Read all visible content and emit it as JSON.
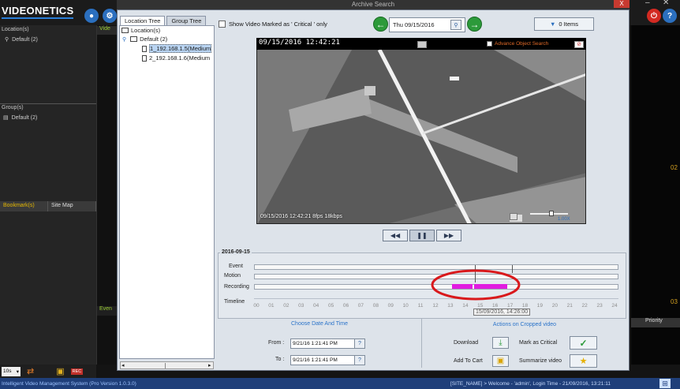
{
  "app": {
    "brand": "VIDEONETICS",
    "locations_header": "Location(s)",
    "locations_default": "Default (2)",
    "groups_header": "Group(s)",
    "groups_default": "Default (2)",
    "mid_strip_labels": [
      "Vide",
      "Even"
    ],
    "bookmark_tabs": [
      "Bookmark(s)",
      "Site Map"
    ],
    "right_strip": {
      "top_number": "02",
      "bottom_number": "03",
      "priority": "Priority"
    },
    "toolbar_dropdown": "10s",
    "toolbar_rec": "REC",
    "status_left": "Intelligent Video Management System (Pro Version 1.0.3.0)",
    "status_right": "[SITE_NAME] > Welcome - 'admin',  Login Time - 21/09/2016, 13:21:11"
  },
  "dialog": {
    "title": "Archive Search",
    "close": "X",
    "tree_tabs": [
      "Location Tree",
      "Group Tree"
    ],
    "tree": {
      "root": "Location(s)",
      "folder": "Default (2)",
      "cameras": [
        "1_192.168.1.5(Medium",
        "2_192.168.1.6(Medium"
      ]
    },
    "critical_label": "Show Video Marked as ' Critical ' only",
    "date": "Thu 09/15/2016",
    "items_label": "0 Items",
    "video": {
      "top_timestamp": "09/15/2016 12:42:21",
      "advance_search": "Advance Object Search",
      "bottom_info": "09/15/2016 12:42:21  8fps 18kbps",
      "speed_label": "1.00X"
    },
    "timeline": {
      "date": "2016-09-15",
      "rows": [
        "Event",
        "Motion",
        "Recording"
      ],
      "axis_label": "Timeline",
      "hours": [
        "00",
        "01",
        "02",
        "03",
        "04",
        "05",
        "06",
        "07",
        "08",
        "09",
        "10",
        "11",
        "12",
        "13",
        "14",
        "15",
        "16",
        "17",
        "18",
        "19",
        "20",
        "21",
        "22",
        "23",
        "24"
      ],
      "recording_segments": [
        [
          13.1,
          14.5
        ],
        [
          14.6,
          16.8
        ]
      ],
      "tooltip": "15/09/2016, 14:26:00"
    },
    "choose_title": "Choose Date And Time",
    "from_label": "From :",
    "from_value": "9/21/16 1:21:41 PM",
    "to_label": "To :",
    "to_value": "9/21/16 1:21:41 PM",
    "actions_title": "Actions on Cropped video",
    "download": "Download",
    "mark_critical": "Mark as Critical",
    "add_to_cart": "Add To Cart",
    "summarize": "Summarize video"
  },
  "colors": {
    "recording": "#e11be0",
    "annotation": "#d9191c",
    "accent": "#2a73c9"
  }
}
